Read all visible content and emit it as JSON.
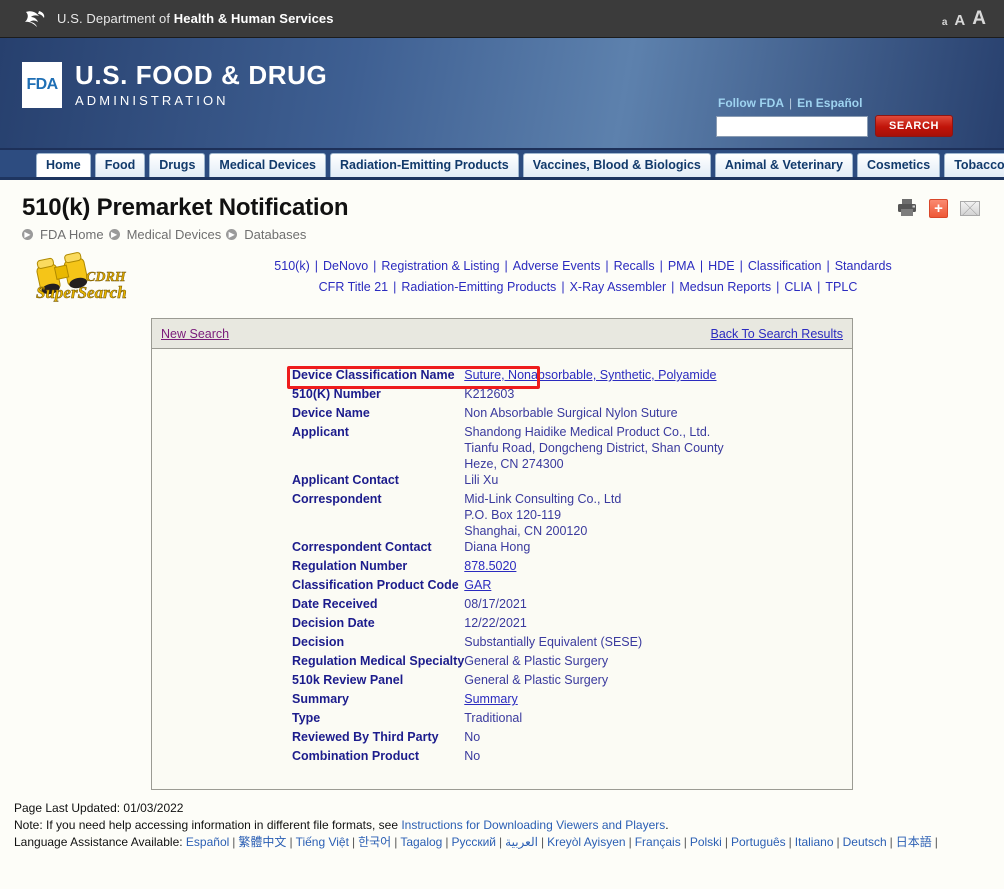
{
  "hhs": {
    "text_prefix": "U.S. Department of ",
    "text_bold": "Health & Human Services",
    "logo_icon": "hhs-eagle-logo",
    "font_sizes": [
      "a",
      "A",
      "A"
    ]
  },
  "fda": {
    "logo_box": "FDA",
    "title_line1": "U.S. FOOD & DRUG",
    "title_line2": "ADMINISTRATION",
    "follow_label": "Follow FDA",
    "separator": "|",
    "espanol_label": "En Español",
    "search_value": "",
    "search_placeholder": "",
    "search_button": "SEARCH"
  },
  "nav": {
    "tabs": [
      {
        "label": "Home",
        "active": true
      },
      {
        "label": "Food",
        "active": false
      },
      {
        "label": "Drugs",
        "active": false
      },
      {
        "label": "Medical Devices",
        "active": false
      },
      {
        "label": "Radiation-Emitting Products",
        "active": false
      },
      {
        "label": "Vaccines, Blood & Biologics",
        "active": false
      },
      {
        "label": "Animal & Veterinary",
        "active": false
      },
      {
        "label": "Cosmetics",
        "active": false
      },
      {
        "label": "Tobacco Products",
        "active": false
      }
    ]
  },
  "header": {
    "title": "510(k) Premarket Notification",
    "breadcrumbs": [
      "FDA Home",
      "Medical Devices",
      "Databases"
    ],
    "icons": [
      "print-icon",
      "share-plus-icon",
      "email-icon"
    ]
  },
  "supersearch": {
    "logo_alt": "CDRH SuperSearch",
    "logo_line1": "CDRH",
    "logo_line2": "SuperSearch",
    "links_row1": [
      "510(k)",
      "DeNovo",
      "Registration & Listing",
      "Adverse Events",
      "Recalls",
      "PMA",
      "HDE",
      "Classification",
      "Standards"
    ],
    "links_row2": [
      "CFR Title 21",
      "Radiation-Emitting Products",
      "X-Ray Assembler",
      "Medsun Reports",
      "CLIA",
      "TPLC"
    ]
  },
  "panel": {
    "new_search": "New Search",
    "back_to_results": "Back To Search Results",
    "rows": [
      {
        "label": "Device Classification Name",
        "value": "Suture, Nonabsorbable, Synthetic, Polyamide",
        "link": true
      },
      {
        "label": "510(K) Number",
        "value": "K212603",
        "link": false,
        "highlighted": true
      },
      {
        "label": "Device Name",
        "value": "Non Absorbable Surgical Nylon Suture",
        "link": false
      },
      {
        "label": "Applicant",
        "value": "Shandong Haidike Medical Product Co., Ltd.",
        "link": false,
        "extra_lines": [
          "Tianfu Road, Dongcheng District, Shan County",
          "Heze,  CN 274300"
        ]
      },
      {
        "label": "Applicant Contact",
        "value": "Lili Xu",
        "link": false
      },
      {
        "label": "Correspondent",
        "value": "Mid-Link Consulting Co., Ltd",
        "link": false,
        "extra_lines": [
          "P.O. Box 120-119",
          "Shanghai,  CN 200120"
        ]
      },
      {
        "label": "Correspondent Contact",
        "value": "Diana Hong",
        "link": false
      },
      {
        "label": "Regulation Number",
        "value": "878.5020",
        "link": true
      },
      {
        "label": "Classification Product Code",
        "value": "GAR",
        "link": true
      },
      {
        "label": "Date Received",
        "value": "08/17/2021",
        "link": false
      },
      {
        "label": "Decision Date",
        "value": "12/22/2021",
        "link": false
      },
      {
        "label": "Decision",
        "value": "Substantially Equivalent (SESE)",
        "link": false
      },
      {
        "label": "Regulation Medical Specialty",
        "value": "General & Plastic Surgery",
        "link": false
      },
      {
        "label": "510k Review Panel",
        "value": "General & Plastic Surgery",
        "link": false
      },
      {
        "label": "Summary",
        "value": "Summary",
        "link": true
      },
      {
        "label": "Type",
        "value": "Traditional",
        "link": false
      },
      {
        "label": "Reviewed By Third Party",
        "value": "No",
        "link": false
      },
      {
        "label": "Combination Product",
        "value": "No",
        "link": false
      }
    ],
    "highlight_color": "#ee1c1c"
  },
  "footer": {
    "last_updated": "Page Last Updated: 01/03/2022",
    "note_prefix": "Note: If you need help accessing information in different file formats, see ",
    "note_link": "Instructions for Downloading Viewers and Players",
    "note_suffix": ".",
    "language_label": "Language Assistance Available:",
    "languages": [
      "Español",
      "繁體中文",
      "Tiếng Việt",
      "한국어",
      "Tagalog",
      "Русский",
      "العربية",
      "Kreyòl Ayisyen",
      "Français",
      "Polski",
      "Português",
      "Italiano",
      "Deutsch",
      "日本語"
    ]
  }
}
